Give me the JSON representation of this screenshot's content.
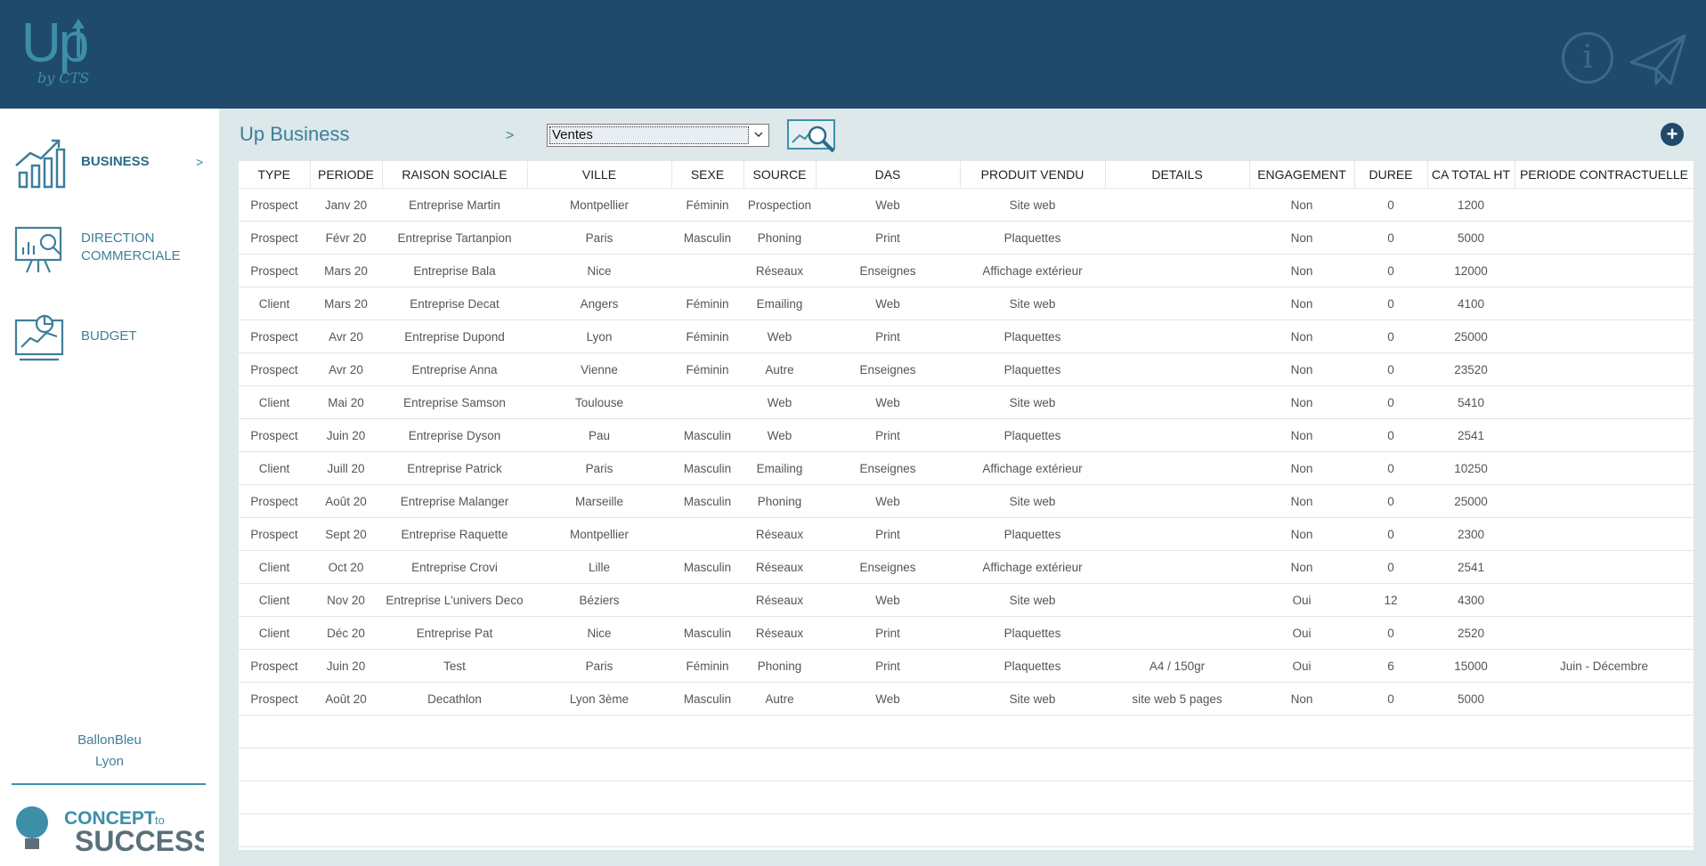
{
  "header": {
    "logo_text": "Up",
    "logo_sub": "by CTS",
    "info_symbol": "i"
  },
  "sidebar": {
    "items": [
      {
        "label": "BUSINESS",
        "arrow": ">",
        "icon": "bar-chart-growth-icon"
      },
      {
        "label": "DIRECTION\nCOMMERCIALE",
        "icon": "presentation-magnifier-icon"
      },
      {
        "label": "BUDGET",
        "icon": "analytics-report-icon"
      }
    ],
    "user_name": "BallonBleu",
    "user_city": "Lyon",
    "brand_logo": "CONCEPT to SUCCESS"
  },
  "main": {
    "title": "Up Business",
    "crumb_arrow": ">",
    "view_select": "Ventes",
    "add_symbol": "+"
  },
  "table": {
    "columns": [
      "TYPE",
      "PERIODE",
      "RAISON SOCIALE",
      "VILLE",
      "SEXE",
      "SOURCE",
      "DAS",
      "PRODUIT VENDU",
      "DETAILS",
      "ENGAGEMENT",
      "DUREE",
      "CA TOTAL HT",
      "PERIODE CONTRACTUELLE"
    ],
    "rows": [
      [
        "Prospect",
        "Janv 20",
        "Entreprise Martin",
        "Montpellier",
        "Féminin",
        "Prospection",
        "Web",
        "Site web",
        "",
        "Non",
        "0",
        "1200",
        ""
      ],
      [
        "Prospect",
        "Févr 20",
        "Entreprise Tartanpion",
        "Paris",
        "Masculin",
        "Phoning",
        "Print",
        "Plaquettes",
        "",
        "Non",
        "0",
        "5000",
        ""
      ],
      [
        "Prospect",
        "Mars 20",
        "Entreprise Bala",
        "Nice",
        "",
        "Réseaux",
        "Enseignes",
        "Affichage extérieur",
        "",
        "Non",
        "0",
        "12000",
        ""
      ],
      [
        "Client",
        "Mars 20",
        "Entreprise Decat",
        "Angers",
        "Féminin",
        "Emailing",
        "Web",
        "Site web",
        "",
        "Non",
        "0",
        "4100",
        ""
      ],
      [
        "Prospect",
        "Avr 20",
        "Entreprise Dupond",
        "Lyon",
        "Féminin",
        "Web",
        "Print",
        "Plaquettes",
        "",
        "Non",
        "0",
        "25000",
        ""
      ],
      [
        "Prospect",
        "Avr 20",
        "Entreprise Anna",
        "Vienne",
        "Féminin",
        "Autre",
        "Enseignes",
        "Plaquettes",
        "",
        "Non",
        "0",
        "23520",
        ""
      ],
      [
        "Client",
        "Mai 20",
        "Entreprise Samson",
        "Toulouse",
        "",
        "Web",
        "Web",
        "Site web",
        "",
        "Non",
        "0",
        "5410",
        ""
      ],
      [
        "Prospect",
        "Juin 20",
        "Entreprise Dyson",
        "Pau",
        "Masculin",
        "Web",
        "Print",
        "Plaquettes",
        "",
        "Non",
        "0",
        "2541",
        ""
      ],
      [
        "Client",
        "Juill 20",
        "Entreprise Patrick",
        "Paris",
        "Masculin",
        "Emailing",
        "Enseignes",
        "Affichage extérieur",
        "",
        "Non",
        "0",
        "10250",
        ""
      ],
      [
        "Prospect",
        "Août 20",
        "Entreprise Malanger",
        "Marseille",
        "Masculin",
        "Phoning",
        "Web",
        "Site web",
        "",
        "Non",
        "0",
        "25000",
        ""
      ],
      [
        "Prospect",
        "Sept 20",
        "Entreprise Raquette",
        "Montpellier",
        "",
        "Réseaux",
        "Print",
        "Plaquettes",
        "",
        "Non",
        "0",
        "2300",
        ""
      ],
      [
        "Client",
        "Oct 20",
        "Entreprise Crovi",
        "Lille",
        "Masculin",
        "Réseaux",
        "Enseignes",
        "Affichage extérieur",
        "",
        "Non",
        "0",
        "2541",
        ""
      ],
      [
        "Client",
        "Nov 20",
        "Entreprise L'univers Deco",
        "Béziers",
        "",
        "Réseaux",
        "Web",
        "Site web",
        "",
        "Oui",
        "12",
        "4300",
        ""
      ],
      [
        "Client",
        "Déc 20",
        "Entreprise Pat",
        "Nice",
        "Masculin",
        "Réseaux",
        "Print",
        "Plaquettes",
        "",
        "Oui",
        "0",
        "2520",
        ""
      ],
      [
        "Prospect",
        "Juin 20",
        "Test",
        "Paris",
        "Féminin",
        "Phoning",
        "Print",
        "Plaquettes",
        "A4 / 150gr",
        "Oui",
        "6",
        "15000",
        "Juin - Décembre"
      ],
      [
        "Prospect",
        "Août 20",
        "Decathlon",
        "Lyon 3ème",
        "Masculin",
        "Autre",
        "Web",
        "Site web",
        "site web 5 pages",
        "Non",
        "0",
        "5000",
        ""
      ]
    ]
  }
}
